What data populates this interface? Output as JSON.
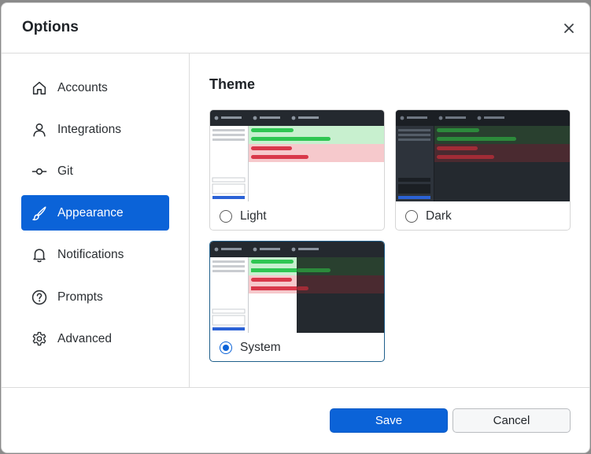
{
  "dialog": {
    "title": "Options",
    "close_icon": "close-icon"
  },
  "sidebar": {
    "items": [
      {
        "label": "Accounts",
        "icon": "home-icon",
        "active": false
      },
      {
        "label": "Integrations",
        "icon": "person-icon",
        "active": false
      },
      {
        "label": "Git",
        "icon": "git-commit-icon",
        "active": false
      },
      {
        "label": "Appearance",
        "icon": "paintbrush-icon",
        "active": true
      },
      {
        "label": "Notifications",
        "icon": "bell-icon",
        "active": false
      },
      {
        "label": "Prompts",
        "icon": "question-circle-icon",
        "active": false
      },
      {
        "label": "Advanced",
        "icon": "gear-icon",
        "active": false
      }
    ]
  },
  "theme": {
    "title": "Theme",
    "options": [
      {
        "label": "Light",
        "selected": false
      },
      {
        "label": "Dark",
        "selected": false
      },
      {
        "label": "System",
        "selected": true
      }
    ]
  },
  "footer": {
    "save_label": "Save",
    "cancel_label": "Cancel"
  },
  "colors": {
    "accent": "#0b63d8",
    "diff_add_light": "#c8f0cf",
    "diff_del_light": "#f6c9cc",
    "diff_add_bar": "#2fc652",
    "diff_del_bar": "#d9384a",
    "dark_bg": "#24292f"
  }
}
